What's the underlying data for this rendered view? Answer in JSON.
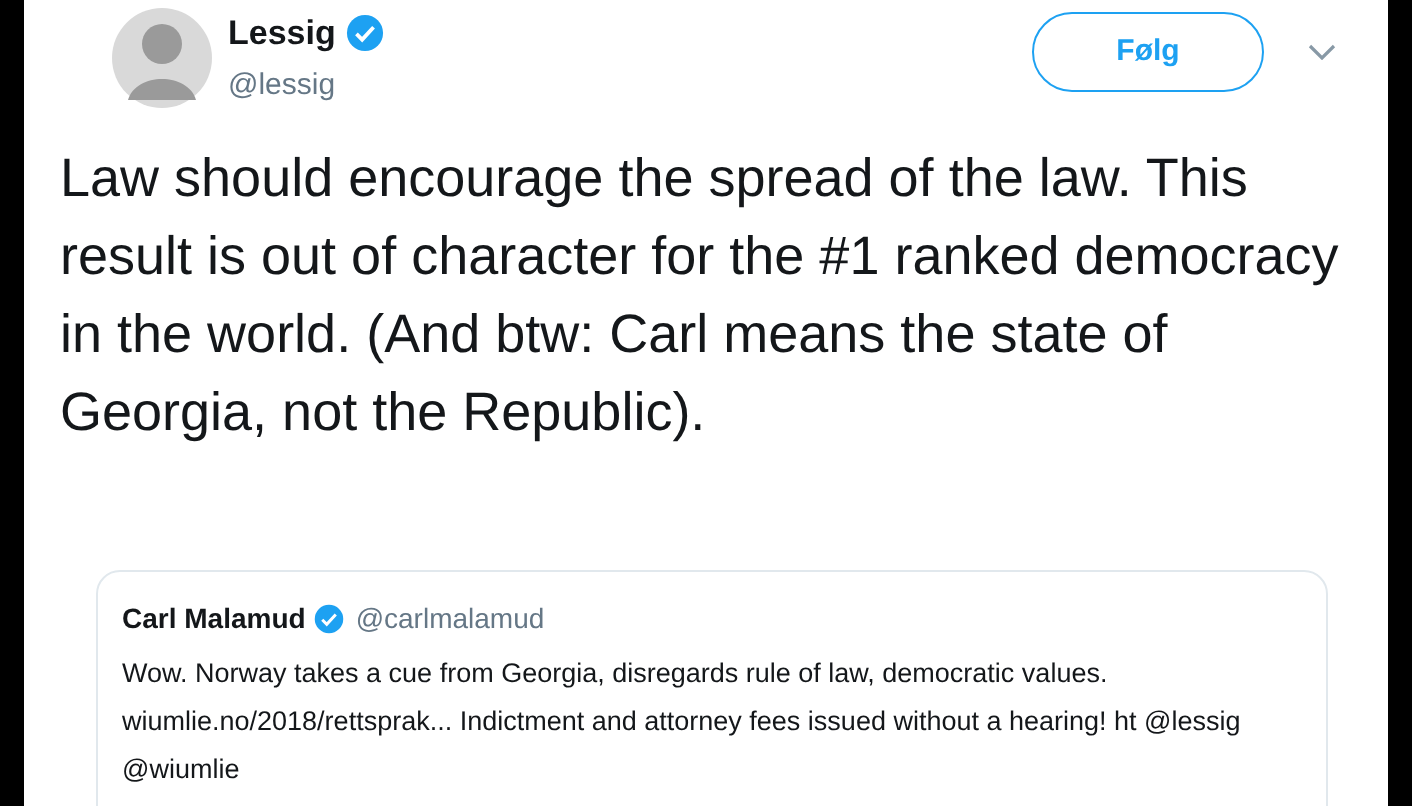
{
  "author": {
    "name": "Lessig",
    "verified": true,
    "handle": "@lessig"
  },
  "follow_button": "Følg",
  "tweet_text": "Law should encourage the spread of the law. This result is out of character for the #1 ranked democracy in the world. (And btw: Carl means the state of Georgia, not the Republic).",
  "quoted_tweet": {
    "name": "Carl Malamud",
    "verified": true,
    "handle": "@carlmalamud",
    "text": "Wow. Norway takes a cue from Georgia, disregards rule of law, democratic values. wiumlie.no/2018/rettsprak... Indictment and attorney fees issued without a hearing! ht @lessig @wiumlie"
  }
}
